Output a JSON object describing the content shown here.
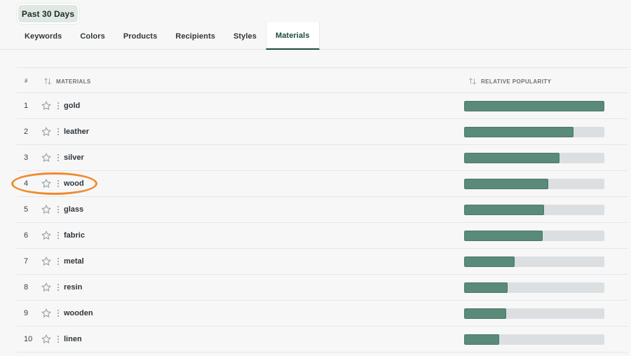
{
  "period_filter": "Past 30 Days",
  "tabs": [
    {
      "label": "Keywords",
      "active": false
    },
    {
      "label": "Colors",
      "active": false
    },
    {
      "label": "Products",
      "active": false
    },
    {
      "label": "Recipients",
      "active": false
    },
    {
      "label": "Styles",
      "active": false
    },
    {
      "label": "Materials",
      "active": true
    }
  ],
  "table": {
    "headers": {
      "rank": "#",
      "materials": "MATERIALS",
      "popularity": "RELATIVE POPULARITY"
    },
    "rows": [
      {
        "rank": "1",
        "label": "gold",
        "popularity": 1.0
      },
      {
        "rank": "2",
        "label": "leather",
        "popularity": 0.78
      },
      {
        "rank": "3",
        "label": "silver",
        "popularity": 0.68
      },
      {
        "rank": "4",
        "label": "wood",
        "popularity": 0.6
      },
      {
        "rank": "5",
        "label": "glass",
        "popularity": 0.57
      },
      {
        "rank": "6",
        "label": "fabric",
        "popularity": 0.56
      },
      {
        "rank": "7",
        "label": "metal",
        "popularity": 0.36
      },
      {
        "rank": "8",
        "label": "resin",
        "popularity": 0.31
      },
      {
        "rank": "9",
        "label": "wooden",
        "popularity": 0.3
      },
      {
        "rank": "10",
        "label": "linen",
        "popularity": 0.25
      }
    ]
  },
  "colors": {
    "accent": "#1d4a3a",
    "bar": "#5a8a7a",
    "track": "#dcdfe2",
    "highlight": "#f08a2e"
  },
  "icons": {
    "favorite": "star-icon",
    "more": "kebab-icon",
    "sort": "sort-icon"
  }
}
